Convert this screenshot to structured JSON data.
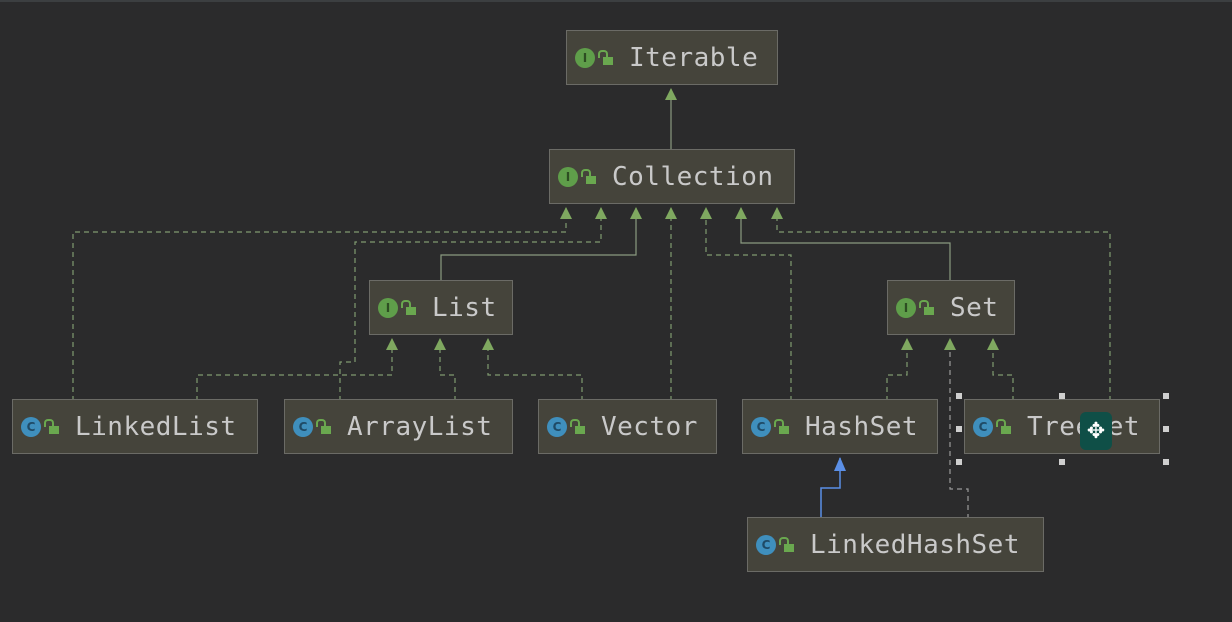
{
  "diagram": {
    "nodes": {
      "iterable": {
        "name": "Iterable",
        "kind": "interface",
        "badge": "I"
      },
      "collection": {
        "name": "Collection",
        "kind": "interface",
        "badge": "I"
      },
      "list": {
        "name": "List",
        "kind": "interface",
        "badge": "I"
      },
      "set": {
        "name": "Set",
        "kind": "interface",
        "badge": "I"
      },
      "linkedlist": {
        "name": "LinkedList",
        "kind": "class",
        "badge": "C"
      },
      "arraylist": {
        "name": "ArrayList",
        "kind": "class",
        "badge": "C"
      },
      "vector": {
        "name": "Vector",
        "kind": "class",
        "badge": "C"
      },
      "hashset": {
        "name": "HashSet",
        "kind": "class",
        "badge": "C"
      },
      "treeset": {
        "name": "TreeSet",
        "kind": "class",
        "badge": "C",
        "selected": true
      },
      "linkedhashset": {
        "name": "LinkedHashSet",
        "kind": "class",
        "badge": "C"
      }
    },
    "colors": {
      "background": "#2b2b2c",
      "extends": "#8aa868",
      "implements": "#8aa868",
      "class_extends": "#5b8fe6",
      "interface_badge": "#5f9e4a",
      "class_badge": "#3f8fbd"
    },
    "edges": [
      {
        "from": "Collection",
        "to": "Iterable",
        "type": "extends"
      },
      {
        "from": "List",
        "to": "Collection",
        "type": "extends"
      },
      {
        "from": "Set",
        "to": "Collection",
        "type": "extends"
      },
      {
        "from": "LinkedList",
        "to": "Collection",
        "type": "implements"
      },
      {
        "from": "ArrayList",
        "to": "Collection",
        "type": "implements"
      },
      {
        "from": "Vector",
        "to": "Collection",
        "type": "implements"
      },
      {
        "from": "HashSet",
        "to": "Collection",
        "type": "implements"
      },
      {
        "from": "TreeSet",
        "to": "Collection",
        "type": "implements"
      },
      {
        "from": "LinkedList",
        "to": "List",
        "type": "implements"
      },
      {
        "from": "ArrayList",
        "to": "List",
        "type": "implements"
      },
      {
        "from": "Vector",
        "to": "List",
        "type": "implements"
      },
      {
        "from": "HashSet",
        "to": "Set",
        "type": "implements"
      },
      {
        "from": "LinkedHashSet",
        "to": "Set",
        "type": "implements"
      },
      {
        "from": "TreeSet",
        "to": "Set",
        "type": "implements"
      },
      {
        "from": "LinkedHashSet",
        "to": "HashSet",
        "type": "class-extends"
      }
    ]
  }
}
